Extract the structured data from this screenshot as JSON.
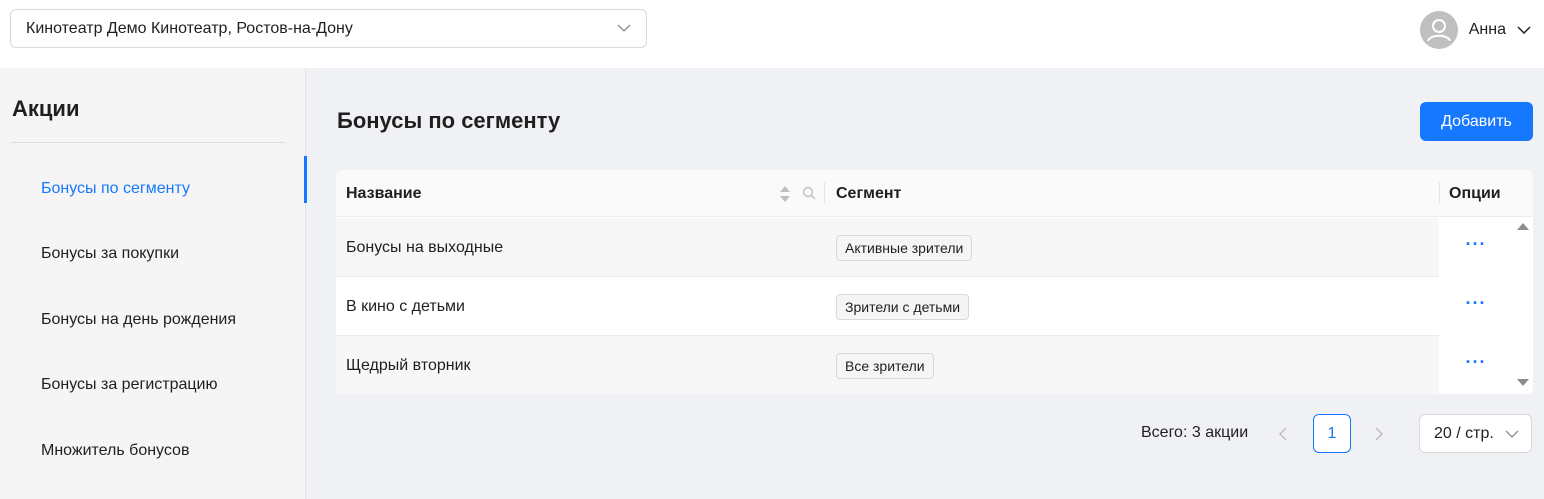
{
  "header": {
    "cinema_select": {
      "value": "Кинотеатр Демо Кинотеатр, Ростов-на-Дону",
      "icon": "chevron-down-icon"
    },
    "user": {
      "name": "Анна",
      "avatar_icon": "user-avatar-icon"
    }
  },
  "sidebar": {
    "title": "Акции",
    "items": [
      {
        "label": "Бонусы по сегменту",
        "active": true
      },
      {
        "label": "Бонусы за покупки",
        "active": false
      },
      {
        "label": "Бонусы на день рождения",
        "active": false
      },
      {
        "label": "Бонусы за регистрацию",
        "active": false
      },
      {
        "label": "Множитель бонусов",
        "active": false
      }
    ]
  },
  "main": {
    "title": "Бонусы по сегменту",
    "add_button": "Добавить",
    "table": {
      "columns": {
        "name": "Название",
        "segment": "Сегмент",
        "options": "Опции"
      },
      "rows": [
        {
          "name": "Бонусы на выходные",
          "segment": "Активные зрители",
          "options": "···"
        },
        {
          "name": "В кино с детьми",
          "segment": "Зрители с детьми",
          "options": "···"
        },
        {
          "name": "Щедрый вторник",
          "segment": "Все зрители",
          "options": "···"
        }
      ]
    },
    "pagination": {
      "total": "Всего: 3 акции",
      "current_page": "1",
      "page_size": "20 / стр."
    }
  },
  "colors": {
    "accent": "#1677ff",
    "background": "#f0f1f4",
    "sidebar_bg": "#f5f5f5"
  }
}
